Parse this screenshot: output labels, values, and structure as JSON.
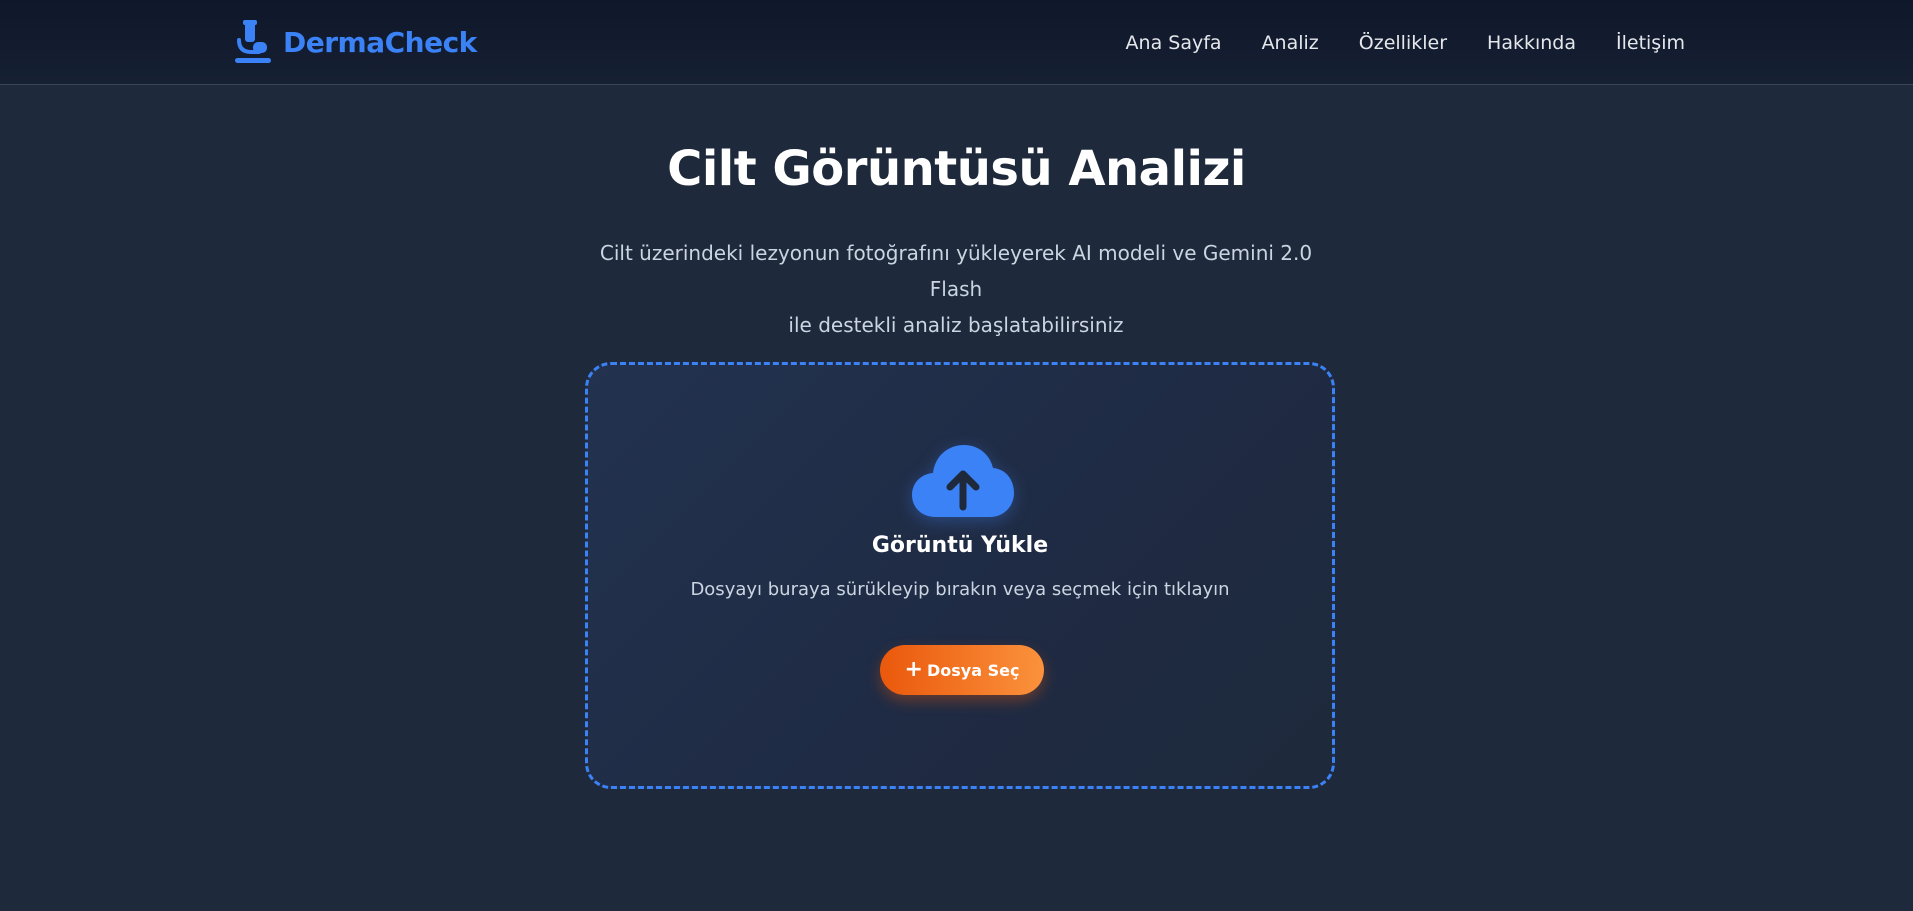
{
  "header": {
    "brand_name": "DermaCheck",
    "brand_icon": "microscope-icon",
    "nav": [
      {
        "label": "Ana Sayfa"
      },
      {
        "label": "Analiz"
      },
      {
        "label": "Özellikler"
      },
      {
        "label": "Hakkında"
      },
      {
        "label": "İletişim"
      }
    ]
  },
  "main": {
    "title": "Cilt Görüntüsü Analizi",
    "subtitle_line1": "Cilt üzerindeki lezyonun fotoğrafını yükleyerek AI modeli ve Gemini 2.0 Flash",
    "subtitle_line2": "ile destekli analiz başlatabilirsiniz"
  },
  "upload": {
    "icon": "cloud-upload-icon",
    "title": "Görüntü Yükle",
    "hint": "Dosyayı buraya sürükleyip bırakın veya seçmek için tıklayın",
    "button_icon": "plus-icon",
    "button_label": "Dosya Seç"
  },
  "colors": {
    "background": "#1e293b",
    "navbar": "#0f172a",
    "accent_blue": "#3b82f6",
    "button_orange_start": "#ea580c",
    "button_orange_end": "#fb923c"
  }
}
